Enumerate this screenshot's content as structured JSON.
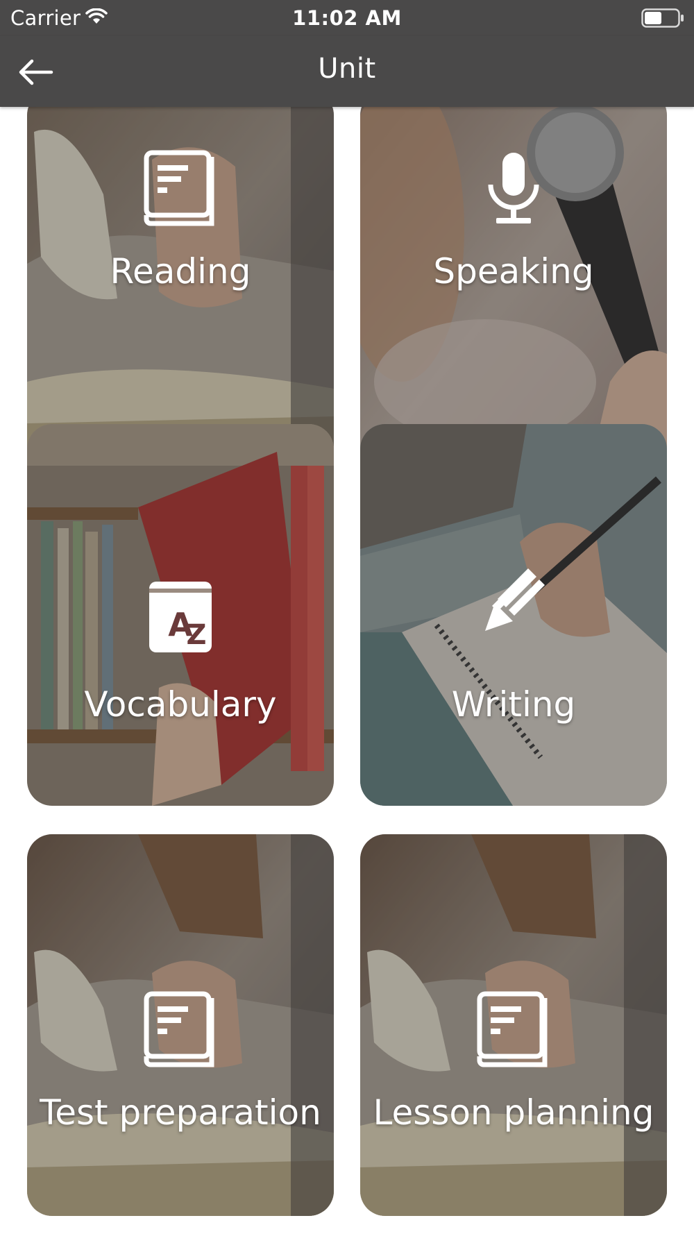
{
  "status_bar": {
    "carrier": "Carrier",
    "time": "11:02 AM"
  },
  "nav": {
    "title": "Unit"
  },
  "tiles": [
    {
      "label": "Reading",
      "icon": "book-icon"
    },
    {
      "label": "Speaking",
      "icon": "microphone-icon"
    },
    {
      "label": "Vocabulary",
      "icon": "az-dictionary-icon"
    },
    {
      "label": "Writing",
      "icon": "pencil-icon"
    },
    {
      "label": "Test preparation",
      "icon": "book-icon"
    },
    {
      "label": "Lesson planning",
      "icon": "book-icon"
    }
  ],
  "colors": {
    "bar": "#4a4949",
    "text": "#ffffff"
  }
}
